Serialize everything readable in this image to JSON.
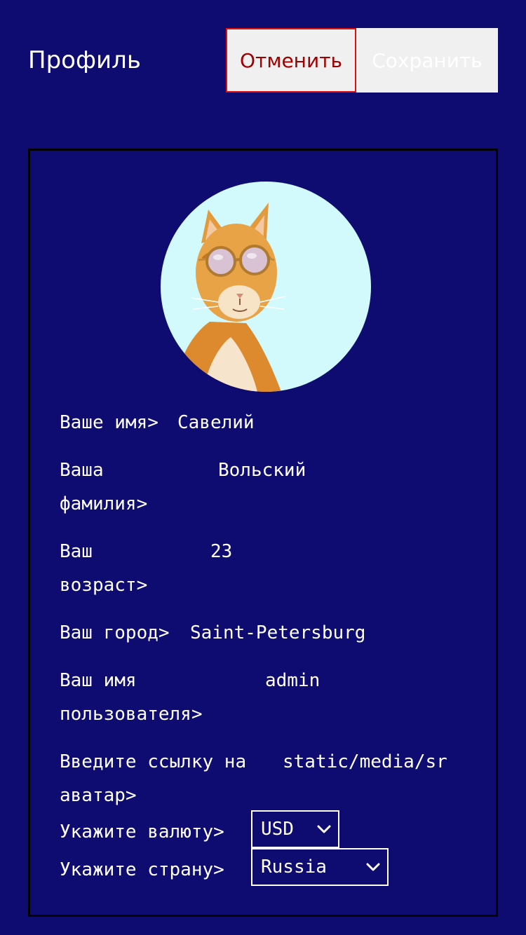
{
  "header": {
    "title": "Профиль",
    "cancel_label": "Отменить",
    "save_label": "Сохранить"
  },
  "profile": {
    "first_name": {
      "label": "Ваше имя>",
      "value": "Савелий"
    },
    "last_name": {
      "label_line1": "Ваша",
      "label_line2": "фамилия>",
      "value": "Вольский"
    },
    "age": {
      "label_line1": "Ваш",
      "label_line2": "возраст>",
      "value": "23"
    },
    "city": {
      "label": "Ваш город>",
      "value": "Saint-Petersburg"
    },
    "username": {
      "label_line1": "Ваш имя",
      "label_line2": "пользователя>",
      "value": "admin"
    },
    "avatar_link": {
      "label_line1": "Введите ссылку на",
      "label_line2": "аватар>",
      "value": "static/media/sr"
    },
    "currency": {
      "label": "Укажите валюту>",
      "selected": "USD"
    },
    "country": {
      "label": "Укажите страну>",
      "selected": "Russia"
    }
  },
  "colors": {
    "background": "#0e0c70",
    "cancel_border": "#e01010",
    "cancel_text": "#a00000",
    "button_bg": "#f0f0f0",
    "avatar_bg": "#d2fafd"
  },
  "icons": {
    "avatar": "cat-with-sunglasses-avatar",
    "select_arrow": "chevron-down-icon"
  }
}
